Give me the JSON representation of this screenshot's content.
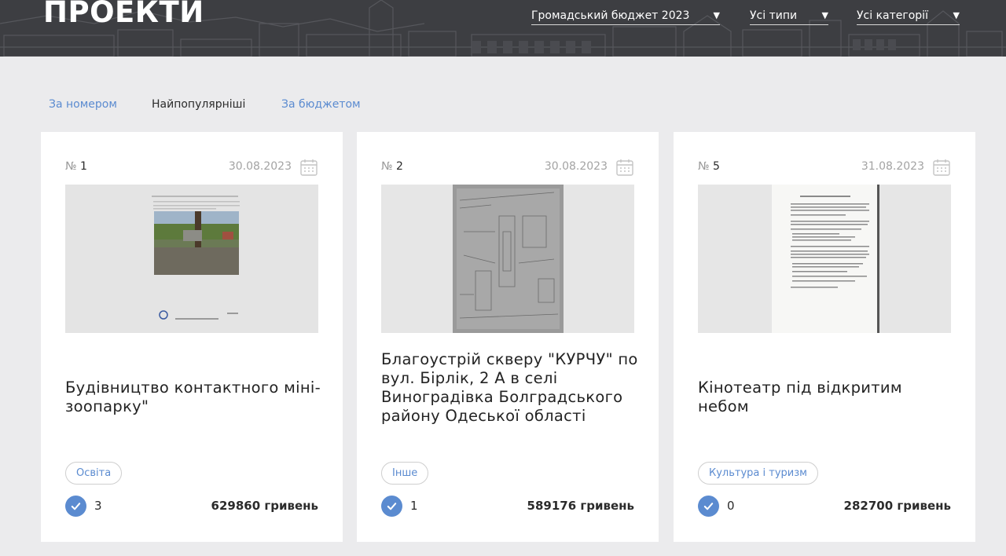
{
  "header": {
    "title": "ПРОЕКТИ",
    "filters": [
      {
        "label": "Громадський бюджет 2023"
      },
      {
        "label": "Усі типи"
      },
      {
        "label": "Усі категорії"
      }
    ]
  },
  "sort": {
    "by_number": "За номером",
    "popular": "Найпопулярніші",
    "by_budget": "За бюджетом"
  },
  "cards": [
    {
      "number_prefix": "№",
      "number": "1",
      "date": "30.08.2023",
      "title": "Будівництво контактного міні-зоопарку\"",
      "tag": "Освіта",
      "votes": "3",
      "budget": "629860 гривень",
      "thumb_kind": "doc-photo"
    },
    {
      "number_prefix": "№",
      "number": "2",
      "date": "30.08.2023",
      "title": "Благоустрій скверу \"КУРЧУ\" по вул. Бірлік, 2 А в селі Виноградівка Болградського району Одеської області",
      "tag": "Інше",
      "votes": "1",
      "budget": "589176 гривень",
      "thumb_kind": "plan-scan"
    },
    {
      "number_prefix": "№",
      "number": "5",
      "date": "31.08.2023",
      "title": "Кінотеатр під відкритим небом",
      "tag": "Культура і туризм",
      "votes": "0",
      "budget": "282700 гривень",
      "thumb_kind": "text-doc"
    }
  ],
  "colors": {
    "header_bg": "#3d3e42",
    "accent": "#5b8bd0",
    "page_bg": "#ebebed"
  }
}
